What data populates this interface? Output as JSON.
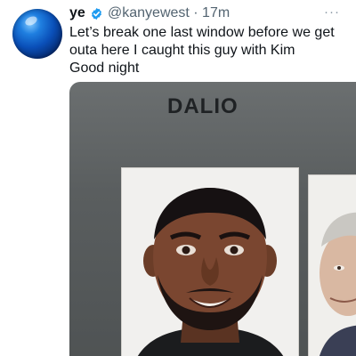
{
  "tweet": {
    "author_name": "ye",
    "handle_time": "@kanyewest · 17m",
    "more_glyph": "···",
    "text": "Let’s break one last window before we get\nouta here    I caught this guy with Kim\nGood night",
    "image_label": "DALIO"
  },
  "colors": {
    "verified_badge": "#1d9bf0",
    "handle_gray": "#536471",
    "text": "#0f1419"
  }
}
